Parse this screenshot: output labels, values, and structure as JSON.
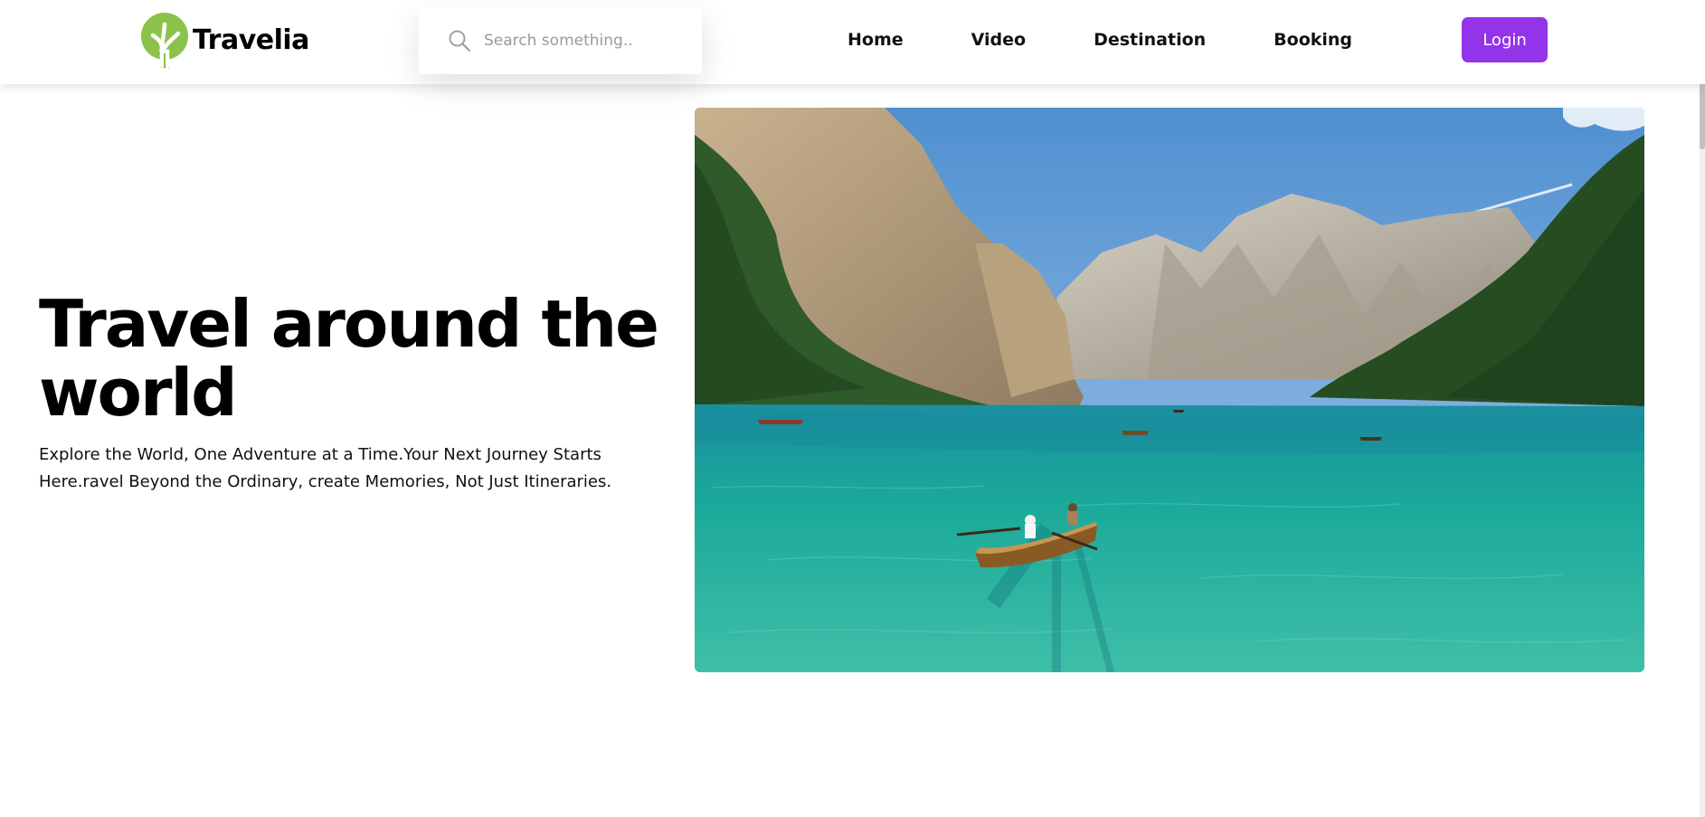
{
  "brand": {
    "name": "Travelia",
    "color": "#8bc34a"
  },
  "search": {
    "placeholder": "Search something.."
  },
  "nav": {
    "items": [
      {
        "label": "Home"
      },
      {
        "label": "Video"
      },
      {
        "label": "Destination"
      },
      {
        "label": "Booking"
      }
    ]
  },
  "login": {
    "label": "Login",
    "color": "#9333ea"
  },
  "hero": {
    "title": "Travel around the world",
    "description": "Explore the World, One Adventure at a Time.Your Next Journey Starts Here.ravel Beyond the Ordinary, create Memories, Not Just Itineraries."
  },
  "icons": {
    "logo": "tree-logo-icon",
    "search": "search-icon"
  }
}
